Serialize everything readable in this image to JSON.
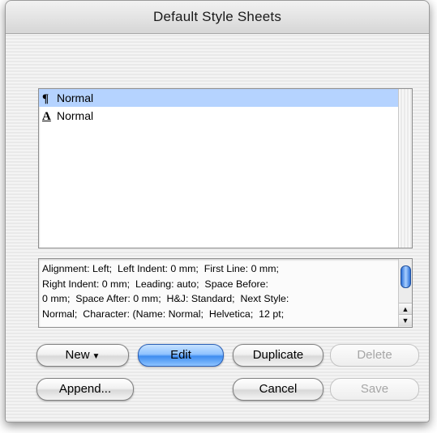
{
  "window": {
    "title": "Default Style Sheets"
  },
  "style_list": {
    "items": [
      {
        "icon": "¶",
        "label": "Normal",
        "selected": true
      },
      {
        "icon": "A",
        "label": "Normal",
        "selected": false
      }
    ]
  },
  "description": {
    "lines": [
      "Alignment: Left;  Left Indent: 0 mm;  First Line: 0 mm;",
      "Right Indent: 0 mm;  Leading: auto;  Space Before:",
      "0 mm;  Space After: 0 mm;  H&J: Standard;  Next Style:",
      "Normal;  Character: (Name: Normal;  Helvetica;  12 pt;"
    ]
  },
  "buttons": {
    "new": "New",
    "edit": "Edit",
    "duplicate": "Duplicate",
    "delete": "Delete",
    "append": "Append...",
    "cancel": "Cancel",
    "save": "Save"
  }
}
